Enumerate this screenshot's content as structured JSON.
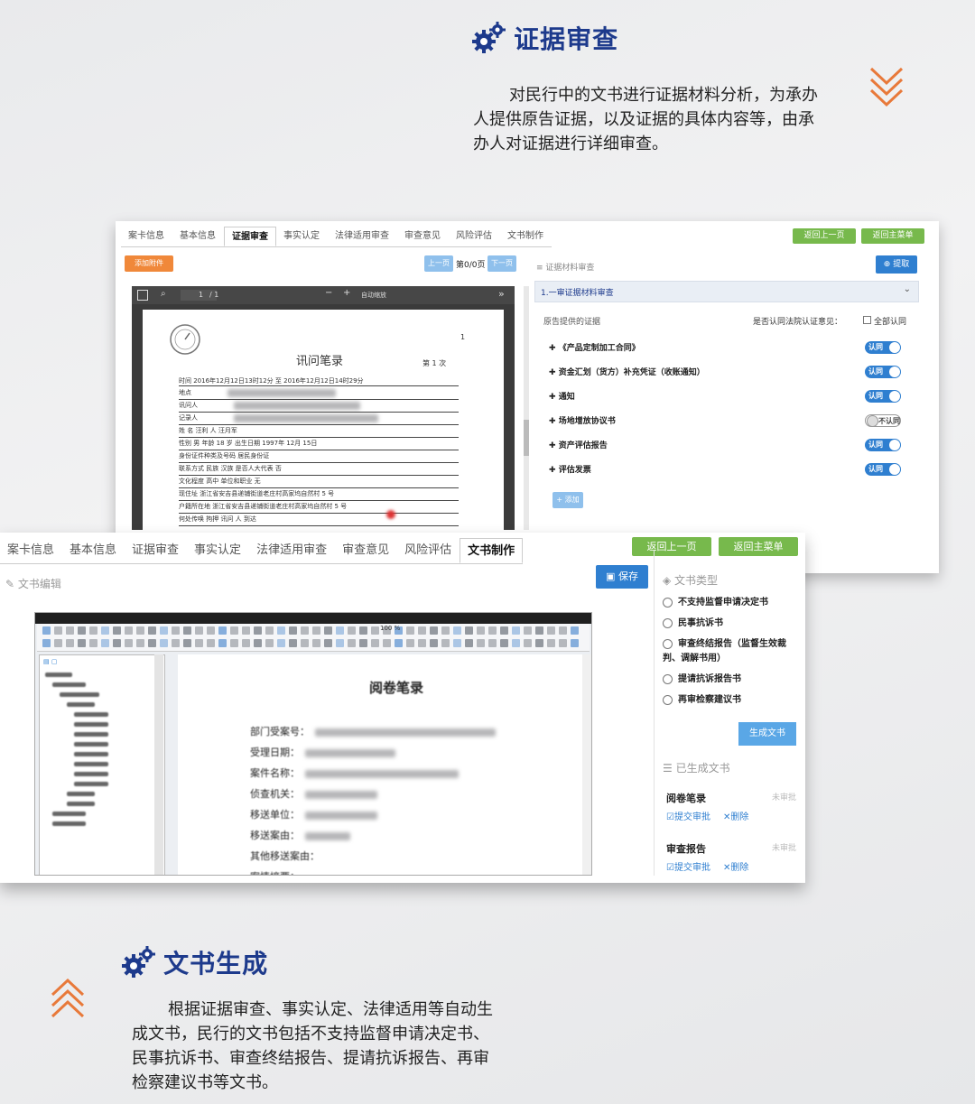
{
  "top_section": {
    "title": "证据审查",
    "description": "对民行中的文书进行证据材料分析，为承办人提供原告证据，以及证据的具体内容等，由承办人对证据进行详细审查。"
  },
  "bottom_section": {
    "title": "文书生成",
    "description": "根据证据审查、事实认定、法律适用等自动生成文书，民行的文书包括不支持监督申请决定书、民事抗诉书、审查终结报告、提请抗诉报告、再审检察建议书等文书。"
  },
  "screen1": {
    "tabs": [
      "案卡信息",
      "基本信息",
      "证据审查",
      "事实认定",
      "法律适用审查",
      "审查意见",
      "风险评估",
      "文书制作"
    ],
    "active_tab": 2,
    "btn_prev_page": "返回上一页",
    "btn_main_menu": "返回主菜单",
    "btn_attach": "添加附件",
    "nav_prev": "上一页",
    "page_indicator": "第0/0页",
    "nav_next": "下一页",
    "btn_extract": "提取",
    "panel_title": "证据材料审查",
    "accordion_title": "1.一审证据材料审查",
    "list_header_left": "原告提供的证据",
    "list_header_right": "是否认同法院认证意见：",
    "all_agree_label": "全部认同",
    "evidence": [
      {
        "name": "《产品定制加工合同》",
        "status": "认同",
        "on": true
      },
      {
        "name": "资金汇划（货方）补充凭证（收账通知）",
        "status": "认同",
        "on": true
      },
      {
        "name": "通知",
        "status": "认同",
        "on": true
      },
      {
        "name": "场地增放协议书",
        "status": "不认同",
        "on": false
      },
      {
        "name": "资产评估报告",
        "status": "认同",
        "on": true
      },
      {
        "name": "评估发票",
        "status": "认同",
        "on": true
      }
    ],
    "btn_add": "+ 添加",
    "pdf": {
      "page": "1",
      "page_total": "/ 1",
      "zoom": "自动缩放",
      "doc_title": "讯问笔录",
      "seq_label": "第  1  次",
      "page_no": "1",
      "time_line": "时间  2016年12月12日13时12分  至  2016年12月12日14时29分",
      "lines": [
        "地点",
        "讯问人",
        "记录人",
        "姓  名  汪利  人  汪月军",
        "性别  男  年龄 18 岁  出生日期 1997年 12月 15日",
        "身份证件种类及号码  居民身份证",
        "联系方式  民族  汉族  是否人大代表  否",
        "文化程度  高中  单位和职业  无",
        "现住址  浙江省安吉县递铺街道老庄村高家坞自然村 5 号",
        "户籍所在地  浙江省安吉县递铺街道老庄村高家坞自然村 5 号",
        "何处传唤  拘押  讯问  人  到达"
      ]
    }
  },
  "screen2": {
    "tabs": [
      "案卡信息",
      "基本信息",
      "证据审查",
      "事实认定",
      "法律适用审查",
      "审查意见",
      "风险评估",
      "文书制作"
    ],
    "active_tab": 7,
    "btn_prev_page": "返回上一页",
    "btn_main_menu": "返回主菜单",
    "editor_title": "文书编辑",
    "btn_save": "保存",
    "doc_type_title": "文书类型",
    "doc_types": [
      "不支持监督申请决定书",
      "民事抗诉书",
      "审查终结报告（监督生效裁判、调解书用）",
      "提请抗诉报告书",
      "再审检察建议书"
    ],
    "btn_generate": "生成文书",
    "generated_title": "已生成文书",
    "generated": [
      {
        "name": "阅卷笔录",
        "status": "未审批",
        "submit": "提交审批",
        "delete": "删除"
      },
      {
        "name": "审查报告",
        "status": "未审批",
        "submit": "提交审批",
        "delete": "删除"
      }
    ],
    "editor": {
      "doc_heading": "阅卷笔录",
      "zoom": "100 %",
      "field_labels": [
        "部门受案号：",
        "受理日期：",
        "案件名称：",
        "侦查机关：",
        "移送单位：",
        "移送案由：",
        "其他移送案由：",
        "案情摘要："
      ]
    }
  },
  "colors": {
    "title_blue": "#1d3a8c",
    "chevron_orange": "#e8793a",
    "tab_green": "#77b94c",
    "primary_blue": "#2f7fd0",
    "attach_orange": "#f0883a"
  },
  "icons": [
    "gear-icon",
    "chevron-down-double-icon",
    "chevron-up-double-icon",
    "save-icon",
    "pencil-icon",
    "list-icon",
    "plus-icon",
    "seal-icon"
  ]
}
